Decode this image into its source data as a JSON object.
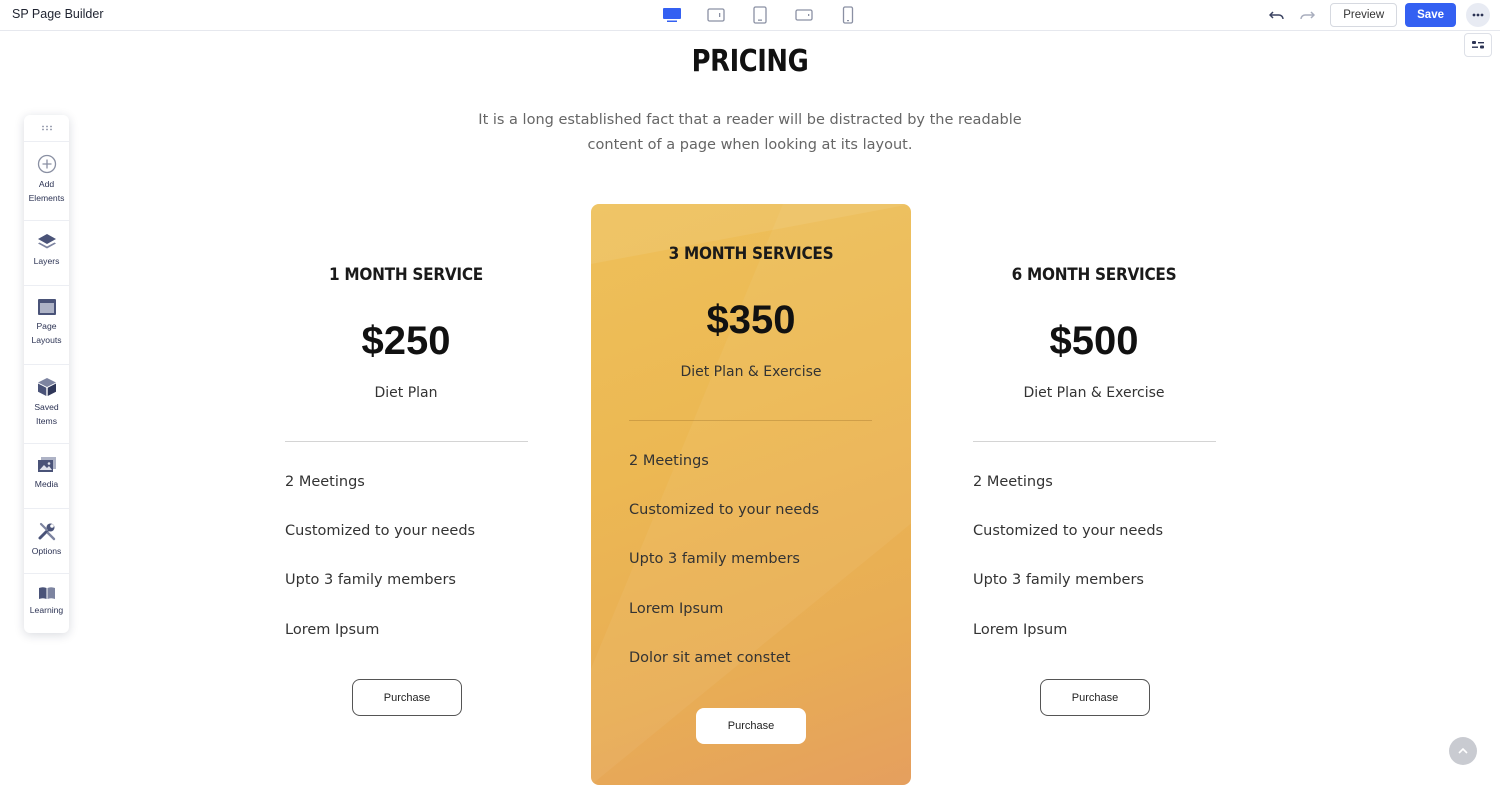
{
  "app": {
    "title": "SP Page Builder"
  },
  "toolbar": {
    "devices": [
      "desktop-icon",
      "tablet-landscape-icon",
      "tablet-portrait-icon",
      "mobile-landscape-icon",
      "mobile-portrait-icon"
    ],
    "preview_label": "Preview",
    "save_label": "Save",
    "accent": "#3460f2"
  },
  "sidebar": {
    "items": [
      {
        "label": "Add Elements",
        "icon": "plus-circle-icon"
      },
      {
        "label": "Layers",
        "icon": "layers-icon"
      },
      {
        "label": "Page Layouts",
        "icon": "layout-icon"
      },
      {
        "label": "Saved Items",
        "icon": "box-icon"
      },
      {
        "label": "Media",
        "icon": "image-icon"
      },
      {
        "label": "Options",
        "icon": "wrench-icon"
      },
      {
        "label": "Learning",
        "icon": "book-icon"
      }
    ]
  },
  "section": {
    "title": "Pricing",
    "subtitle": "It is a long established fact that a reader will be distracted by the readable content of a page when looking at its layout."
  },
  "plans": [
    {
      "name": "1 Month Service",
      "price": "$250",
      "desc": "Diet Plan",
      "features": [
        "2 Meetings",
        "Customized to your needs",
        "Upto 3 family members",
        "Lorem Ipsum"
      ],
      "button": "Purchase"
    },
    {
      "name": "3 Month Services",
      "price": "$350",
      "desc": "Diet Plan & Exercise",
      "features": [
        "2 Meetings",
        "Customized to your needs",
        "Upto 3 family members",
        "Lorem Ipsum",
        "Dolor sit amet constet"
      ],
      "button": "Purchase",
      "highlight_color": "#ecb853"
    },
    {
      "name": "6 Month Services",
      "price": "$500",
      "desc": "Diet Plan & Exercise",
      "features": [
        "2 Meetings",
        "Customized to your needs",
        "Upto 3 family members",
        "Lorem Ipsum"
      ],
      "button": "Purchase"
    }
  ]
}
